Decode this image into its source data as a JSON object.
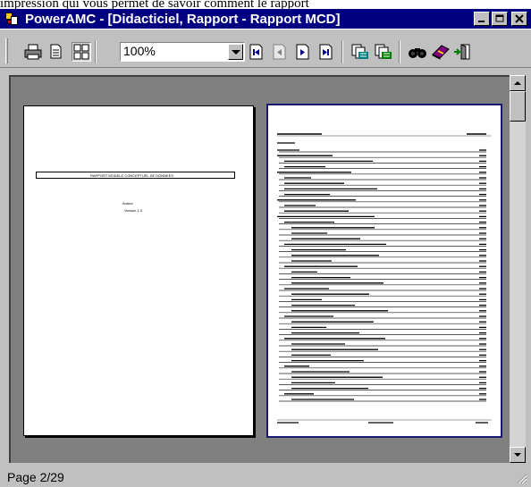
{
  "document_text": "impression qui vous permet de savoir comment le rapport",
  "window": {
    "title": "PowerAMC - [Didacticiel, Rapport - Rapport MCD]",
    "minimize_label": "_",
    "maximize_label": "□",
    "close_label": "×"
  },
  "toolbar": {
    "zoom_value": "100%",
    "icons": [
      "print-icon",
      "single-page-icon",
      "multi-page-icon",
      "first-page-icon",
      "previous-page-icon",
      "next-page-icon",
      "last-page-icon",
      "export-rtf-icon",
      "export-html-icon",
      "find-icon",
      "book-icon",
      "exit-icon"
    ]
  },
  "preview": {
    "title_page_line": "RAPPORT MODELE CONCEPTUEL DE DONNEES",
    "title_page_sub1": "Auteur",
    "title_page_sub2": "Version 1.0"
  },
  "status": {
    "page_text": "Page 2/29"
  },
  "colors": {
    "titlebar": "#000080",
    "face": "#c0c0c0",
    "preview_bg": "#808080"
  }
}
